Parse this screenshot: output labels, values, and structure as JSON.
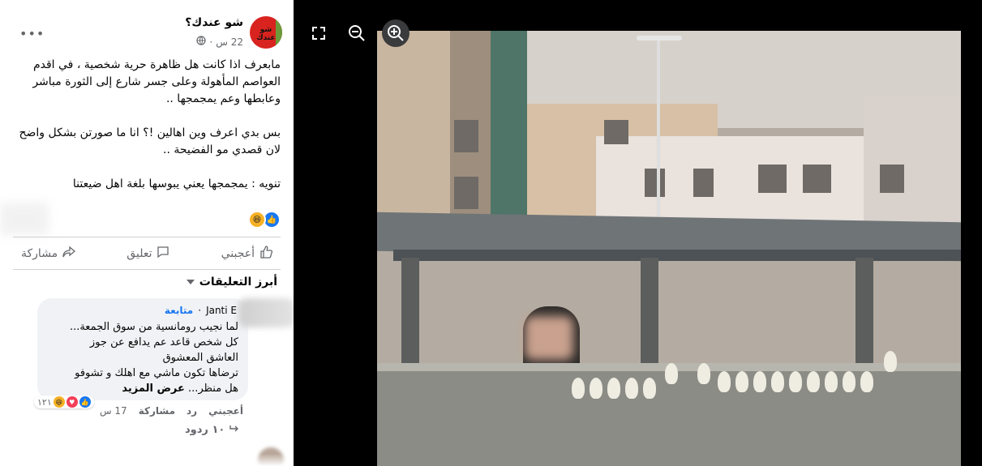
{
  "post": {
    "page_name": "شو عندك؟",
    "avatar_text": "شو عندك",
    "time": "22 س",
    "privacy_icon": "globe-icon",
    "more_icon": "more-icon",
    "paragraphs": [
      "مابعرف اذا كانت هل ظاهرة حرية شخصية ، في اقدم العواصم المأهولة وعلى جسر شارع إلى الثورة مباشر وعابطها وعم يمجمجها ..",
      "بس بدي اعرف وين اهالين !؟ انا ما صورتن بشكل واضح لان قصدي مو الفضيحة ..",
      "تنويه : يمجمجها يعني يبوسها بلغة اهل ضيعتنا"
    ],
    "reaction_icons": [
      "like-icon",
      "haha-icon"
    ]
  },
  "actions": {
    "like": "أعجبني",
    "comment": "تعليق",
    "share": "مشاركة"
  },
  "comments": {
    "sort_label": "أبرز التعليقات",
    "comment": {
      "author": "Janti E",
      "follow": "متابعة",
      "lines": [
        "لما نجيب رومانسية من سوق الجمعة...",
        "كل شخص قاعد عم يدافع عن جوز",
        "العاشق المعشوق",
        "ترضاها تكون ماشي مع اهلك و تشوفو",
        "هل منظر..."
      ],
      "see_more": "عرض المزيد",
      "reaction_count": "١٢١",
      "like": "أعجبني",
      "reply": "رد",
      "share": "مشاركة",
      "time": "17 س"
    },
    "replies": "١٠ ردود"
  },
  "viewer": {
    "fullscreen_icon": "fullscreen-icon",
    "zoom_out_icon": "zoom-out-icon",
    "zoom_in_icon": "zoom-in-icon"
  },
  "colors": {
    "accent": "#1877f2",
    "secondary_text": "#65676b",
    "comment_bg": "#f0f2f5",
    "viewer_bg": "#000000"
  }
}
